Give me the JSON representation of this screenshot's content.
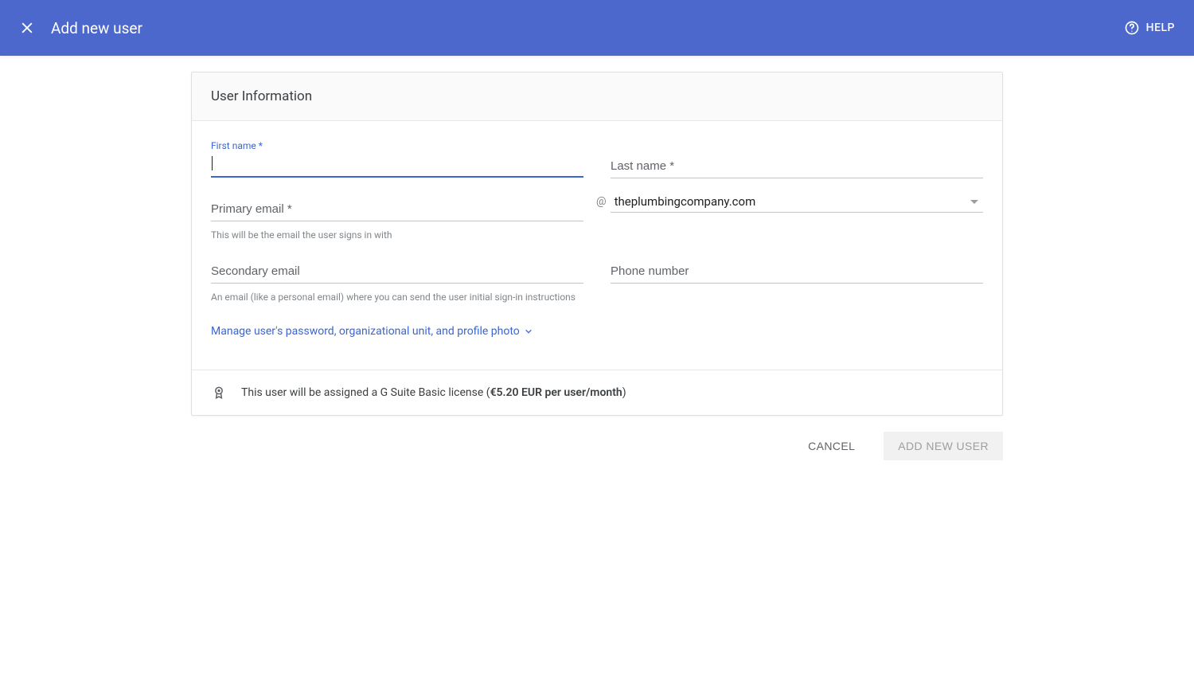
{
  "header": {
    "title": "Add new user",
    "help": "HELP"
  },
  "card": {
    "section_title": "User Information",
    "first_name_label": "First name *",
    "last_name_label": "Last name *",
    "primary_email_label": "Primary email *",
    "primary_email_helper": "This will be the email the user signs in with",
    "at_sign": "@",
    "domain_value": "theplumbingcompany.com",
    "secondary_email_label": "Secondary email",
    "secondary_email_helper": "An email (like a personal email) where you can send the user initial sign-in instructions",
    "phone_label": "Phone number",
    "expand_link": "Manage user's password, organizational unit, and profile photo"
  },
  "license": {
    "text_prefix": "This user will be assigned a G Suite Basic license (",
    "price": "€5.20 EUR per user/month",
    "text_suffix": ")"
  },
  "actions": {
    "cancel": "CANCEL",
    "submit": "ADD NEW USER"
  }
}
